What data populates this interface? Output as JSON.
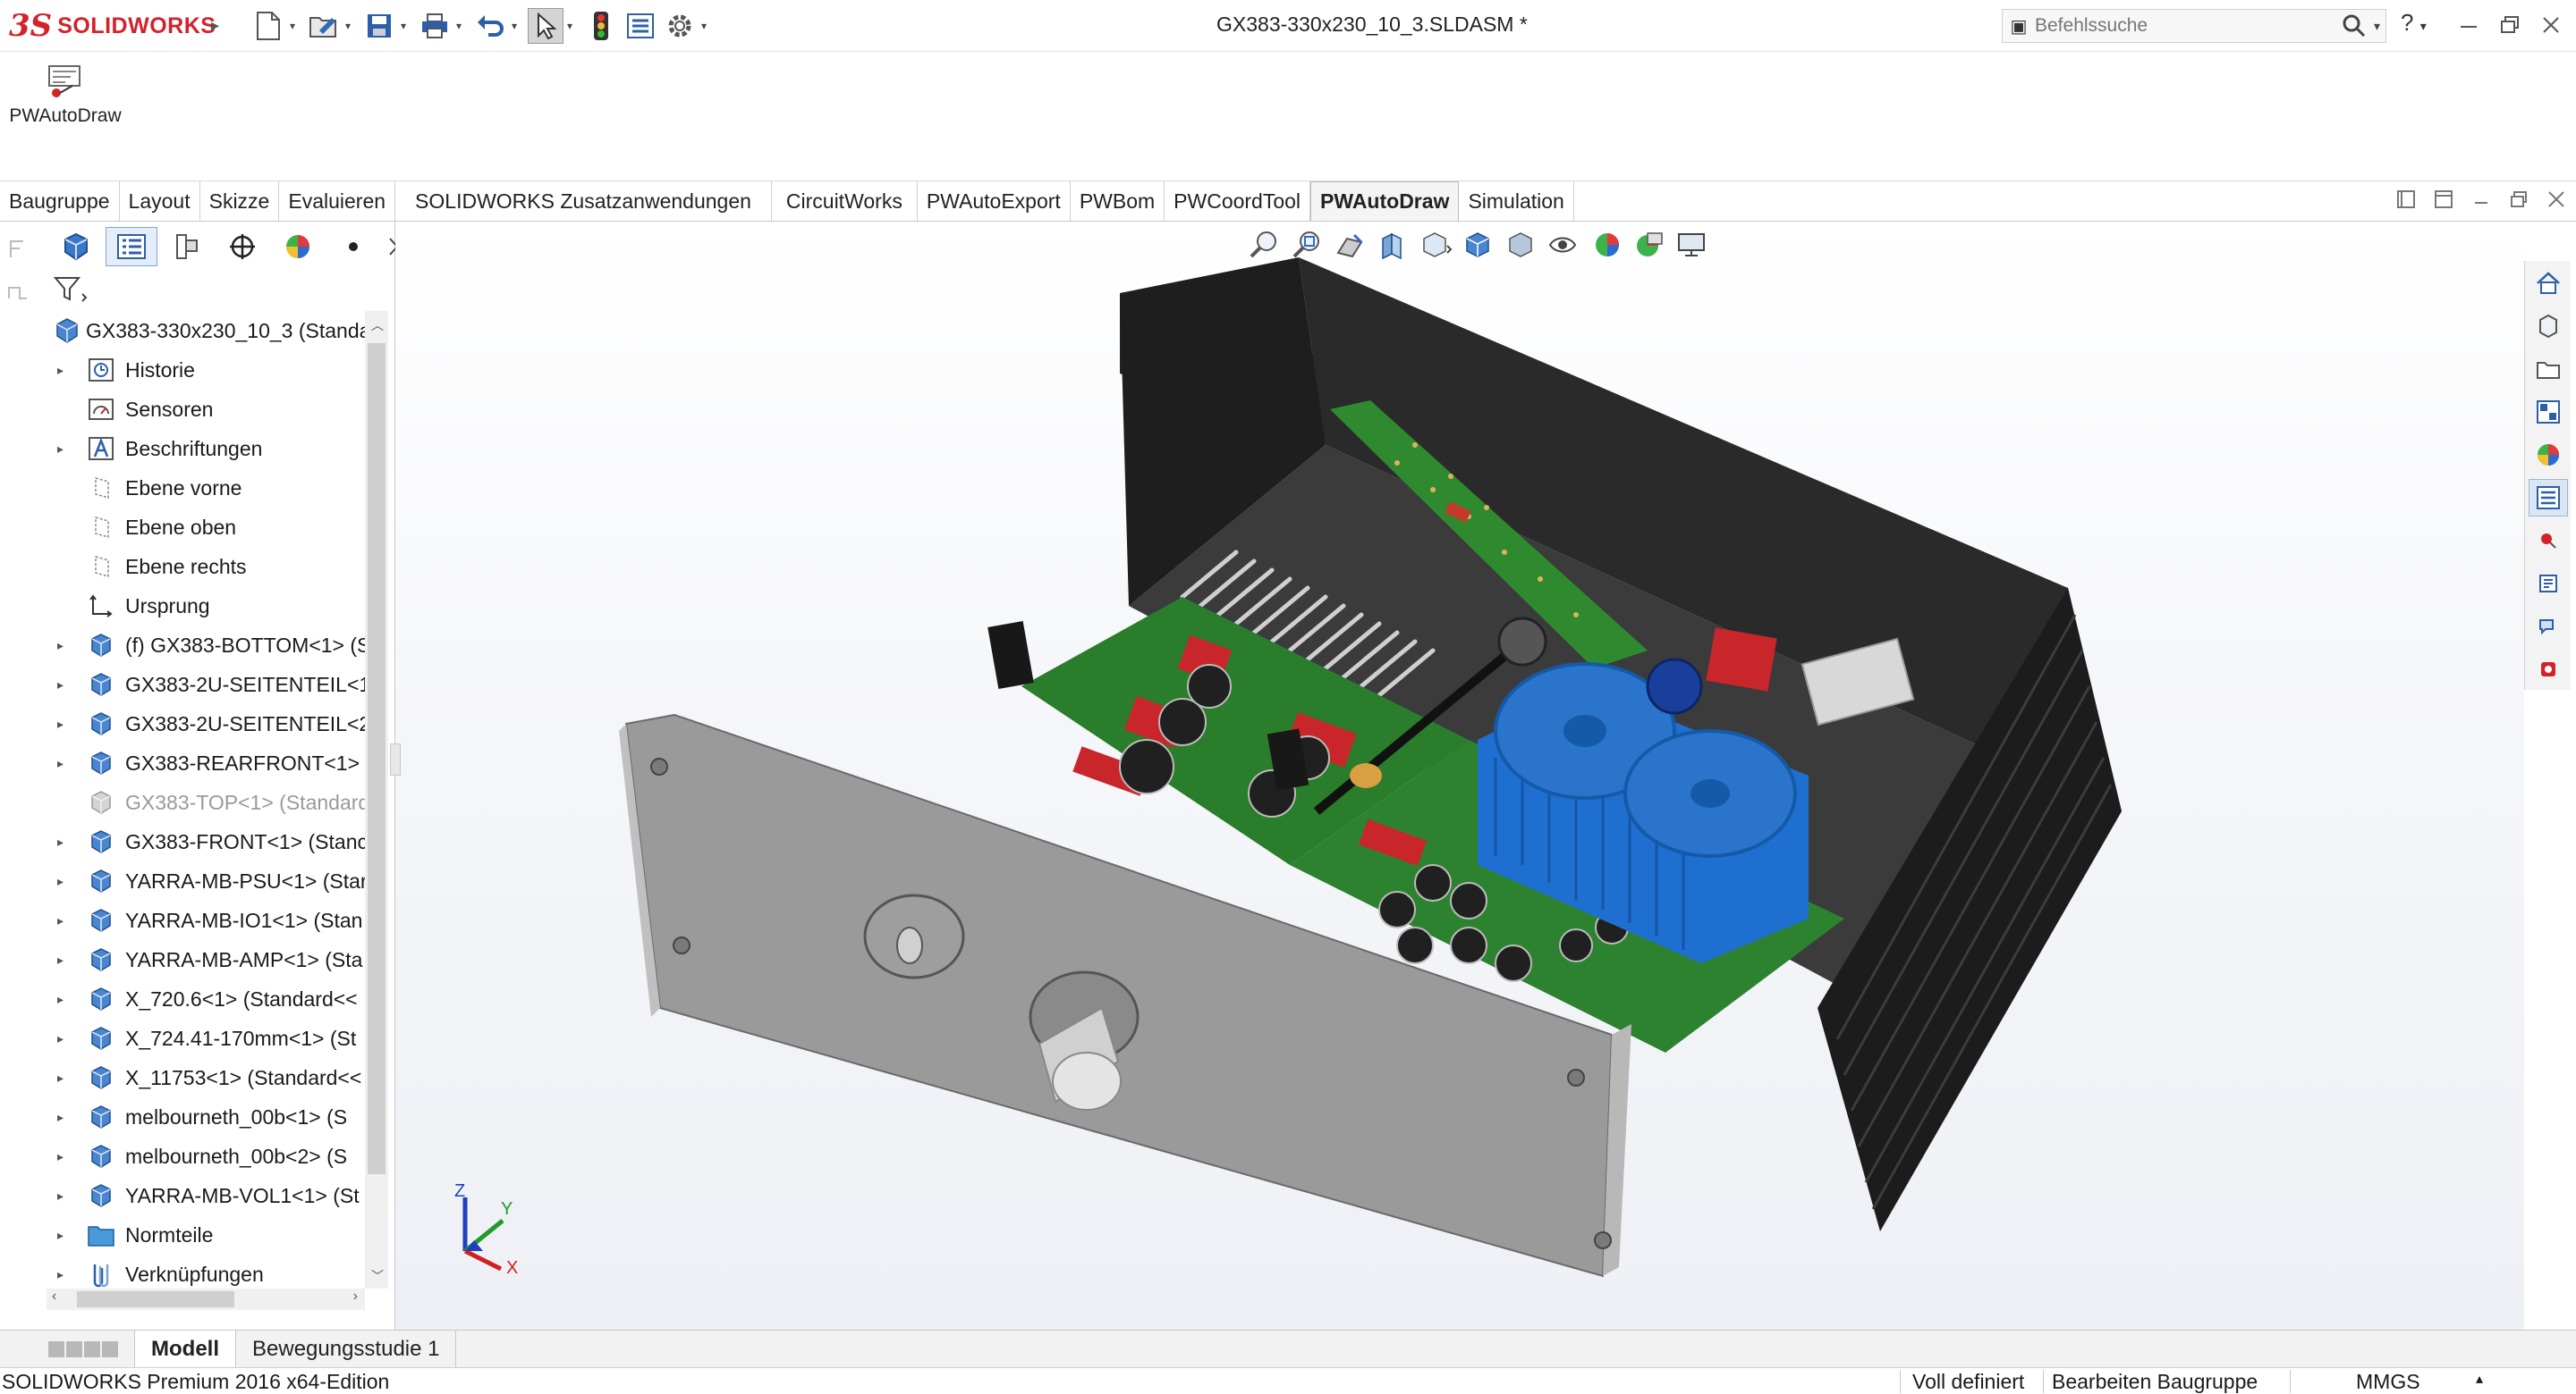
{
  "app": {
    "logo_text": "SOLIDWORKS",
    "document_title": "GX383-330x230_10_3.SLDASM *"
  },
  "search": {
    "placeholder": "Befehlssuche",
    "help_label": "?"
  },
  "command_manager": {
    "button_label": "PWAutoDraw"
  },
  "tabs": [
    {
      "label": "Baugruppe"
    },
    {
      "label": "Layout"
    },
    {
      "label": "Skizze"
    },
    {
      "label": "Evaluieren"
    },
    {
      "label": "SOLIDWORKS Zusatzanwendungen"
    },
    {
      "label": "CircuitWorks"
    },
    {
      "label": "PWAutoExport"
    },
    {
      "label": "PWBom"
    },
    {
      "label": "PWCoordTool"
    },
    {
      "label": "PWAutoDraw",
      "active": true
    },
    {
      "label": "Simulation"
    }
  ],
  "feature_tree": {
    "root": "GX383-330x230_10_3  (Standard",
    "items": [
      {
        "label": "Historie",
        "icon": "history-icon",
        "expandable": true
      },
      {
        "label": "Sensoren",
        "icon": "sensor-icon",
        "expandable": false
      },
      {
        "label": "Beschriftungen",
        "icon": "annotation-icon",
        "expandable": true
      },
      {
        "label": "Ebene vorne",
        "icon": "plane-icon",
        "expandable": false
      },
      {
        "label": "Ebene oben",
        "icon": "plane-icon",
        "expandable": false
      },
      {
        "label": "Ebene rechts",
        "icon": "plane-icon",
        "expandable": false
      },
      {
        "label": "Ursprung",
        "icon": "origin-icon",
        "expandable": false
      },
      {
        "label": "(f) GX383-BOTTOM<1> (S",
        "icon": "part-icon",
        "expandable": true
      },
      {
        "label": "GX383-2U-SEITENTEIL<1:",
        "icon": "part-icon",
        "expandable": true
      },
      {
        "label": "GX383-2U-SEITENTEIL<2:",
        "icon": "part-icon",
        "expandable": true
      },
      {
        "label": "GX383-REARFRONT<1> (",
        "icon": "part-icon",
        "expandable": true
      },
      {
        "label": "GX383-TOP<1> (Standard",
        "icon": "part-icon-suppressed",
        "expandable": false,
        "dim": true
      },
      {
        "label": "GX383-FRONT<1> (Stanc",
        "icon": "part-icon",
        "expandable": true
      },
      {
        "label": "YARRA-MB-PSU<1> (Star",
        "icon": "part-icon",
        "expandable": true
      },
      {
        "label": "YARRA-MB-IO1<1> (Stan",
        "icon": "part-icon",
        "expandable": true
      },
      {
        "label": "YARRA-MB-AMP<1> (Sta",
        "icon": "part-icon",
        "expandable": true
      },
      {
        "label": "X_720.6<1> (Standard<<",
        "icon": "part-icon",
        "expandable": true
      },
      {
        "label": "X_724.41-170mm<1> (St",
        "icon": "part-icon",
        "expandable": true
      },
      {
        "label": "X_11753<1> (Standard<<",
        "icon": "part-icon",
        "expandable": true
      },
      {
        "label": "melbourneth_00b<1> (S",
        "icon": "part-icon",
        "expandable": true
      },
      {
        "label": "melbourneth_00b<2> (S",
        "icon": "part-icon",
        "expandable": true
      },
      {
        "label": "YARRA-MB-VOL1<1> (St",
        "icon": "part-icon",
        "expandable": true
      },
      {
        "label": "Normteile",
        "icon": "folder-icon",
        "expandable": true
      },
      {
        "label": "Verknüpfungen",
        "icon": "mates-icon",
        "expandable": true
      }
    ]
  },
  "triad": {
    "x": "X",
    "y": "Y",
    "z": "Z"
  },
  "bottom_tabs": [
    {
      "label": "Modell",
      "active": true
    },
    {
      "label": "Bewegungsstudie 1"
    }
  ],
  "status": {
    "edition": "SOLIDWORKS Premium 2016 x64-Edition",
    "definition": "Voll definiert",
    "mode": "Bearbeiten Baugruppe",
    "units": "MMGS"
  },
  "colors": {
    "brand": "#d2232a",
    "pcb_green": "#2f8a2f",
    "heatsink_blue": "#1f6fd0",
    "enclosure_dark": "#2b2b2b"
  }
}
